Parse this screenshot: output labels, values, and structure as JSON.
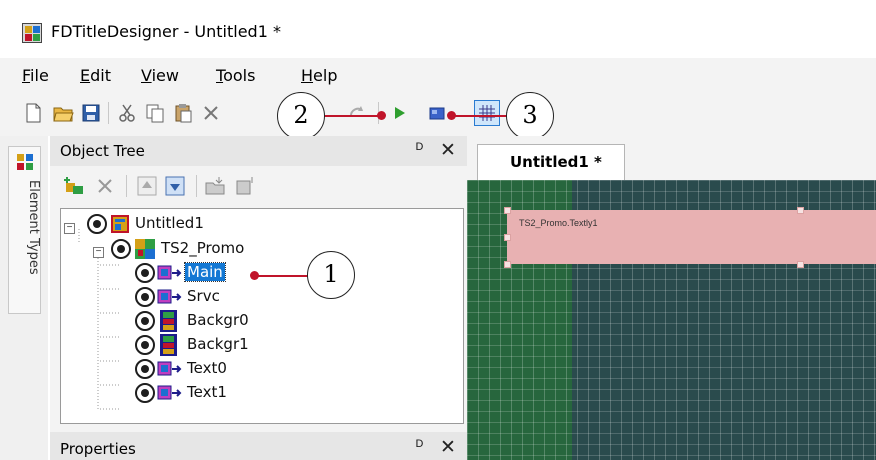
{
  "window": {
    "title": "FDTitleDesigner - Untitled1 *"
  },
  "menu": {
    "items": [
      {
        "label": "File",
        "u": "F",
        "rest": "ile"
      },
      {
        "label": "Edit",
        "u": "E",
        "rest": "dit"
      },
      {
        "label": "View",
        "u": "V",
        "rest": "iew"
      },
      {
        "label": "Tools",
        "u": "T",
        "rest": "ools"
      },
      {
        "label": "Help",
        "u": "H",
        "rest": "elp"
      }
    ]
  },
  "callouts": [
    "1",
    "2",
    "3"
  ],
  "colors": {
    "leader": "#c0142a",
    "selection": "#1478d4",
    "canvas": "#2a4b4d",
    "canvas_strip": "#27663d",
    "title_region": "#e8b1b2"
  },
  "vertical_tab": {
    "label": "Element Types"
  },
  "object_tree": {
    "title": "Object Tree",
    "pin_glyph": "Ṟ",
    "close_glyph": "✕",
    "nodes": [
      {
        "label": "Untitled1",
        "icon": "project-icon"
      },
      {
        "label": "TS2_Promo",
        "icon": "title-set-icon"
      },
      {
        "label": "Main",
        "icon": "region-icon",
        "selected": true
      },
      {
        "label": "Srvc",
        "icon": "region-icon"
      },
      {
        "label": "Backgr0",
        "icon": "video-clip-icon"
      },
      {
        "label": "Backgr1",
        "icon": "video-clip-icon"
      },
      {
        "label": "Text0",
        "icon": "region-icon"
      },
      {
        "label": "Text1",
        "icon": "region-icon"
      }
    ]
  },
  "properties_panel": {
    "title": "Properties"
  },
  "document": {
    "tab": "Untitled1 *",
    "region_caption": "TS2_Promo.Textly1"
  }
}
